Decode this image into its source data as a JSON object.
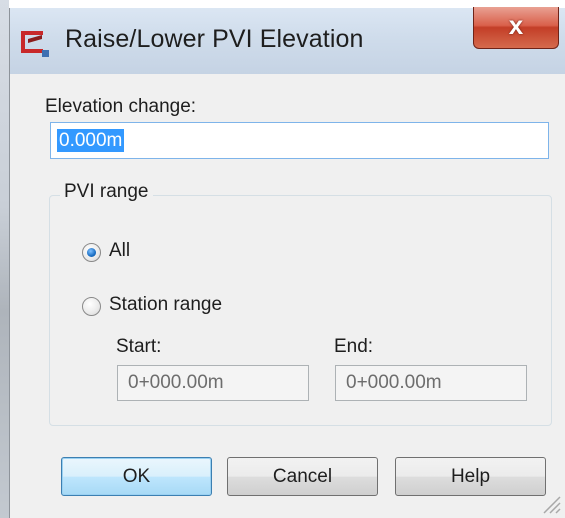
{
  "window": {
    "title": "Raise/Lower PVI Elevation",
    "close_glyph": "x"
  },
  "elevation": {
    "label": "Elevation change:",
    "value": "0.000m"
  },
  "pvi_range": {
    "title": "PVI range",
    "options": [
      {
        "label": "All",
        "checked": true
      },
      {
        "label": "Station range",
        "checked": false
      }
    ],
    "start_label": "Start:",
    "start_value": "0+000.00m",
    "end_label": "End:",
    "end_value": "0+000.00m"
  },
  "buttons": {
    "ok": "OK",
    "cancel": "Cancel",
    "help": "Help"
  },
  "icons": {
    "app": "raise-lower-pvi-app-icon",
    "close": "close-icon",
    "grip": "resize-grip-icon"
  },
  "colors": {
    "selection": "#3399ff",
    "close_button": "#c33e27",
    "default_button": "#bee6fd"
  }
}
